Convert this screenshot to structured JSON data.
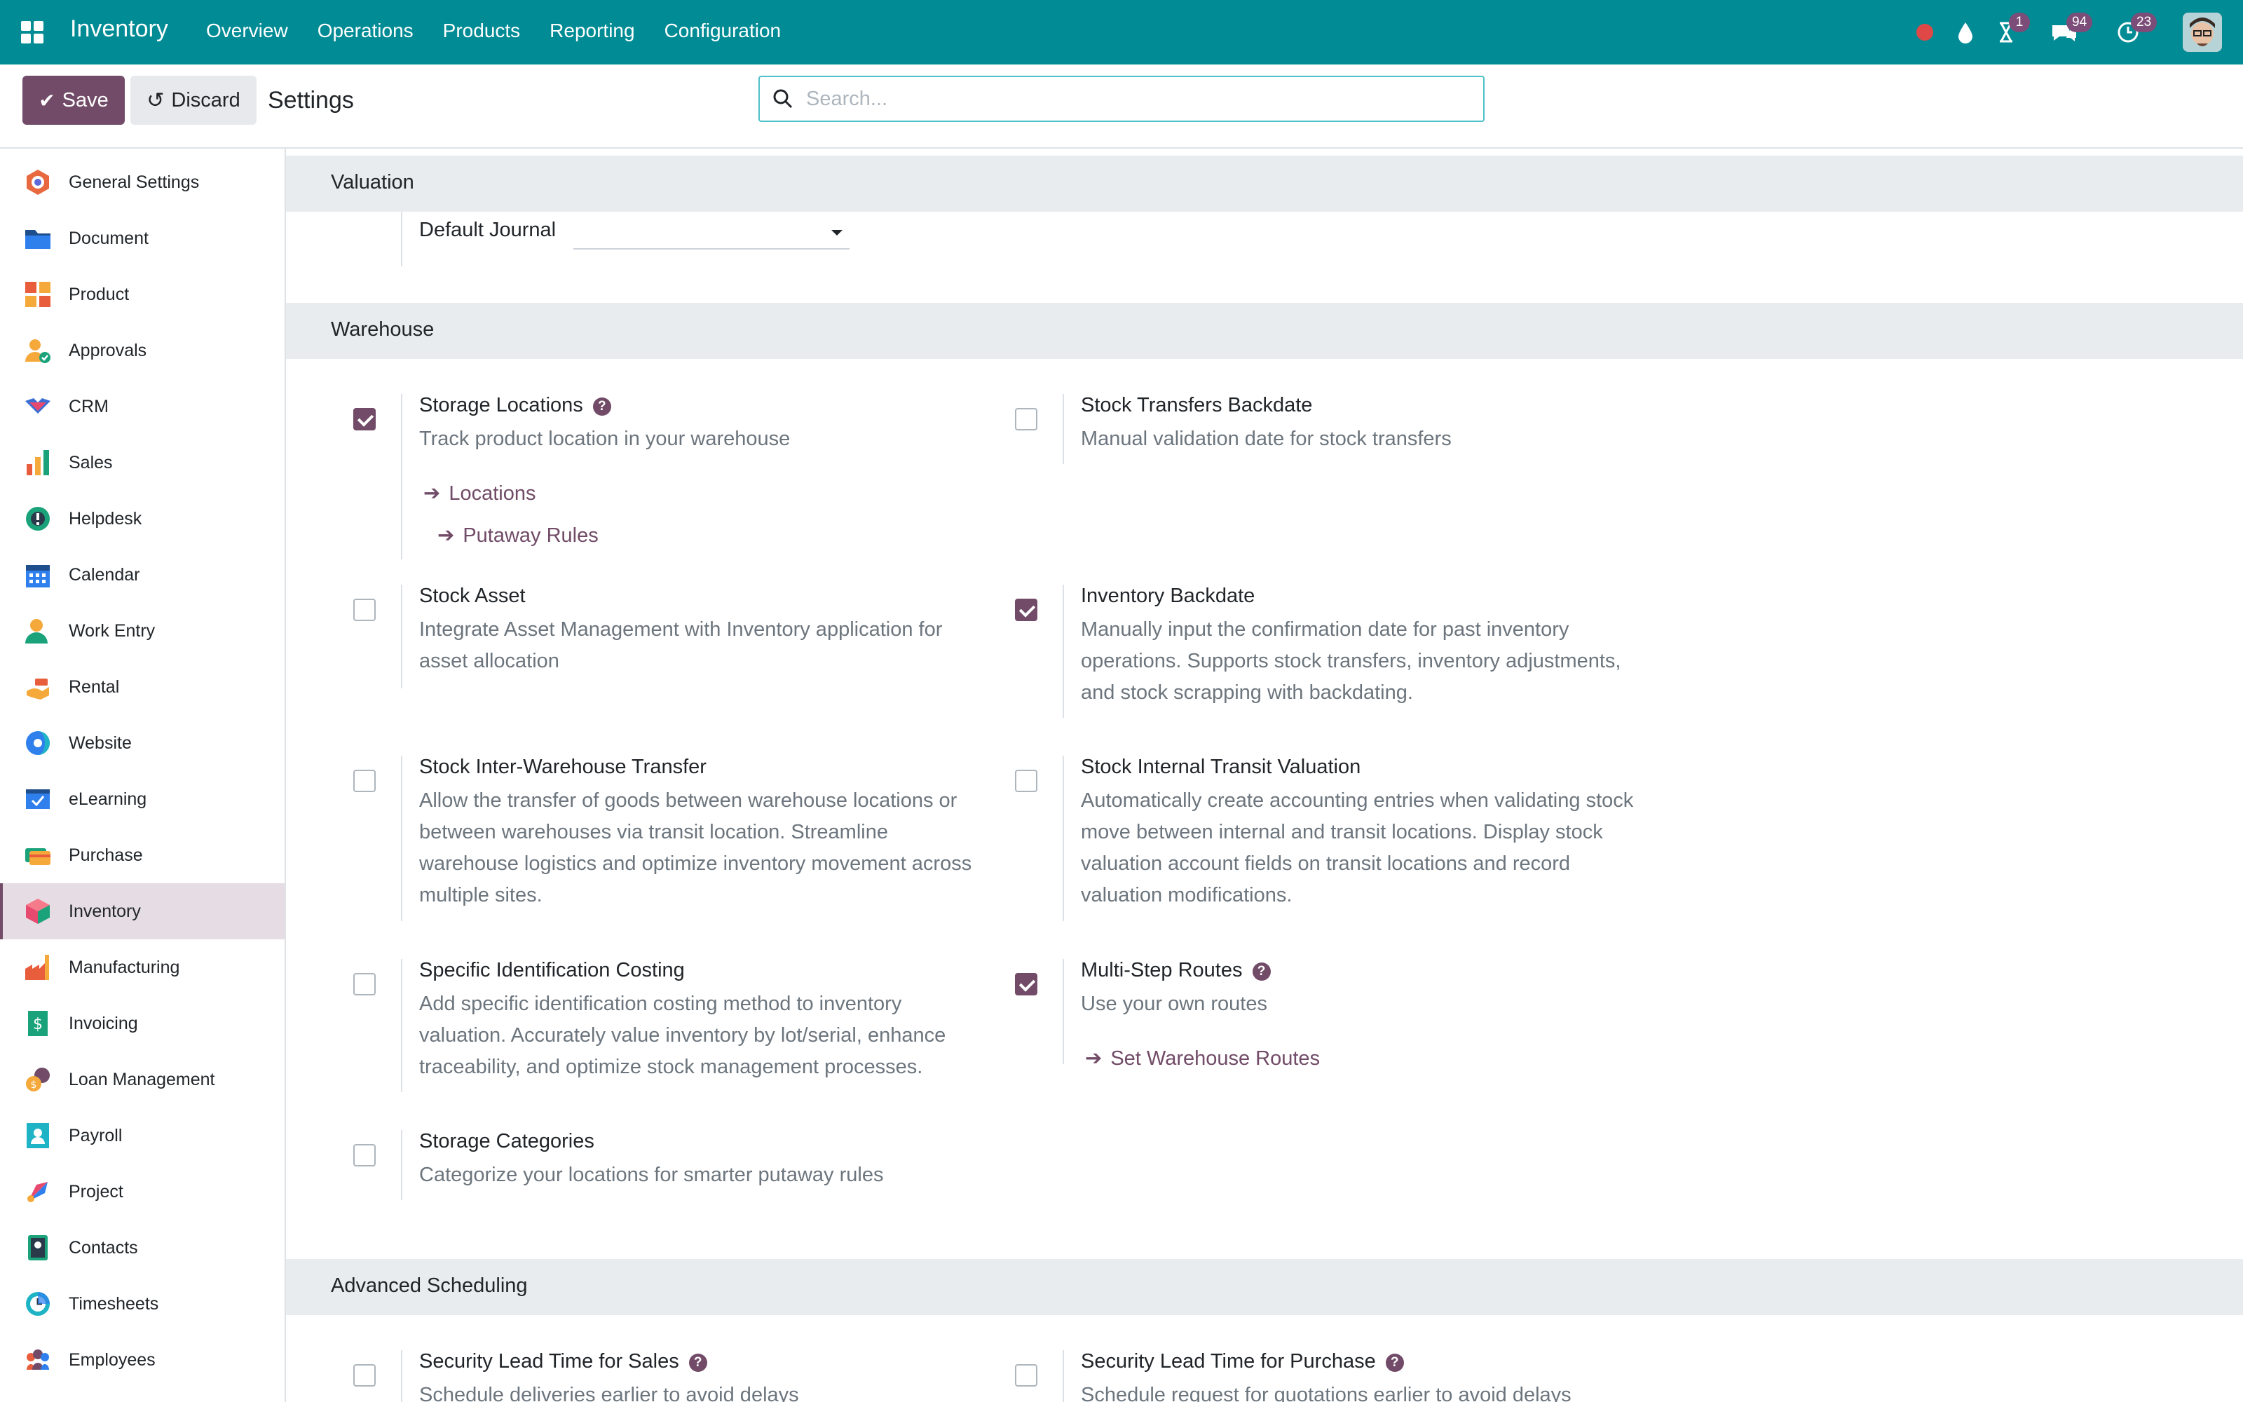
{
  "topbar": {
    "app_name": "Inventory",
    "menu": [
      "Overview",
      "Operations",
      "Products",
      "Reporting",
      "Configuration"
    ],
    "badges": {
      "activity": "1",
      "messages": "94",
      "updates": "23"
    }
  },
  "control": {
    "save_label": "Save",
    "discard_label": "Discard",
    "title": "Settings",
    "search_placeholder": "Search..."
  },
  "sidebar": {
    "items": [
      {
        "label": "General Settings",
        "icon": "general-settings-icon"
      },
      {
        "label": "Document",
        "icon": "document-icon"
      },
      {
        "label": "Product",
        "icon": "product-icon"
      },
      {
        "label": "Approvals",
        "icon": "approvals-icon"
      },
      {
        "label": "CRM",
        "icon": "crm-icon"
      },
      {
        "label": "Sales",
        "icon": "sales-icon"
      },
      {
        "label": "Helpdesk",
        "icon": "helpdesk-icon"
      },
      {
        "label": "Calendar",
        "icon": "calendar-icon"
      },
      {
        "label": "Work Entry",
        "icon": "work-entry-icon"
      },
      {
        "label": "Rental",
        "icon": "rental-icon"
      },
      {
        "label": "Website",
        "icon": "website-icon"
      },
      {
        "label": "eLearning",
        "icon": "elearning-icon"
      },
      {
        "label": "Purchase",
        "icon": "purchase-icon"
      },
      {
        "label": "Inventory",
        "icon": "inventory-icon"
      },
      {
        "label": "Manufacturing",
        "icon": "manufacturing-icon"
      },
      {
        "label": "Invoicing",
        "icon": "invoicing-icon"
      },
      {
        "label": "Loan Management",
        "icon": "loan-management-icon"
      },
      {
        "label": "Payroll",
        "icon": "payroll-icon"
      },
      {
        "label": "Project",
        "icon": "project-icon"
      },
      {
        "label": "Contacts",
        "icon": "contacts-icon"
      },
      {
        "label": "Timesheets",
        "icon": "timesheets-icon"
      },
      {
        "label": "Employees",
        "icon": "employees-icon"
      }
    ],
    "active": "Inventory"
  },
  "sections": {
    "valuation": {
      "title": "Valuation",
      "default_journal_label": "Default Journal",
      "default_journal_value": ""
    },
    "warehouse": {
      "title": "Warehouse",
      "storage_locations": {
        "title": "Storage Locations",
        "desc": "Track product location in your warehouse",
        "checked": true,
        "links": [
          "Locations",
          "Putaway Rules"
        ]
      },
      "stock_transfers_backdate": {
        "title": "Stock Transfers Backdate",
        "desc": "Manual validation date for stock transfers",
        "checked": false
      },
      "stock_asset": {
        "title": "Stock Asset",
        "desc": "Integrate Asset Management with Inventory application for asset allocation",
        "checked": false
      },
      "inventory_backdate": {
        "title": "Inventory Backdate",
        "desc": "Manually input the confirmation date for past inventory operations. Supports stock transfers, inventory adjustments, and stock scrapping with backdating.",
        "checked": true
      },
      "inter_warehouse": {
        "title": "Stock Inter-Warehouse Transfer",
        "desc": "Allow the transfer of goods between warehouse locations or between warehouses via transit location. Streamline warehouse logistics and optimize inventory movement across multiple sites.",
        "checked": false
      },
      "internal_transit": {
        "title": "Stock Internal Transit Valuation",
        "desc": "Automatically create accounting entries when validating stock move between internal and transit locations. Display stock valuation account fields on transit locations and record valuation modifications.",
        "checked": false
      },
      "specific_costing": {
        "title": "Specific Identification Costing",
        "desc": "Add specific identification costing method to inventory valuation. Accurately value inventory by lot/serial, enhance traceability, and optimize stock management processes.",
        "checked": false
      },
      "multi_step": {
        "title": "Multi-Step Routes",
        "desc": "Use your own routes",
        "checked": true,
        "link": "Set Warehouse Routes"
      },
      "storage_categories": {
        "title": "Storage Categories",
        "desc": "Categorize your locations for smarter putaway rules",
        "checked": false
      }
    },
    "advanced": {
      "title": "Advanced Scheduling",
      "lead_sales": {
        "title": "Security Lead Time for Sales",
        "desc": "Schedule deliveries earlier to avoid delays",
        "checked": false
      },
      "lead_purchase": {
        "title": "Security Lead Time for Purchase",
        "desc": "Schedule request for quotations earlier to avoid delays",
        "checked": false
      }
    }
  },
  "colors": {
    "topbar": "#018b95",
    "primary": "#714b67",
    "section_bg": "#e9ecef"
  }
}
